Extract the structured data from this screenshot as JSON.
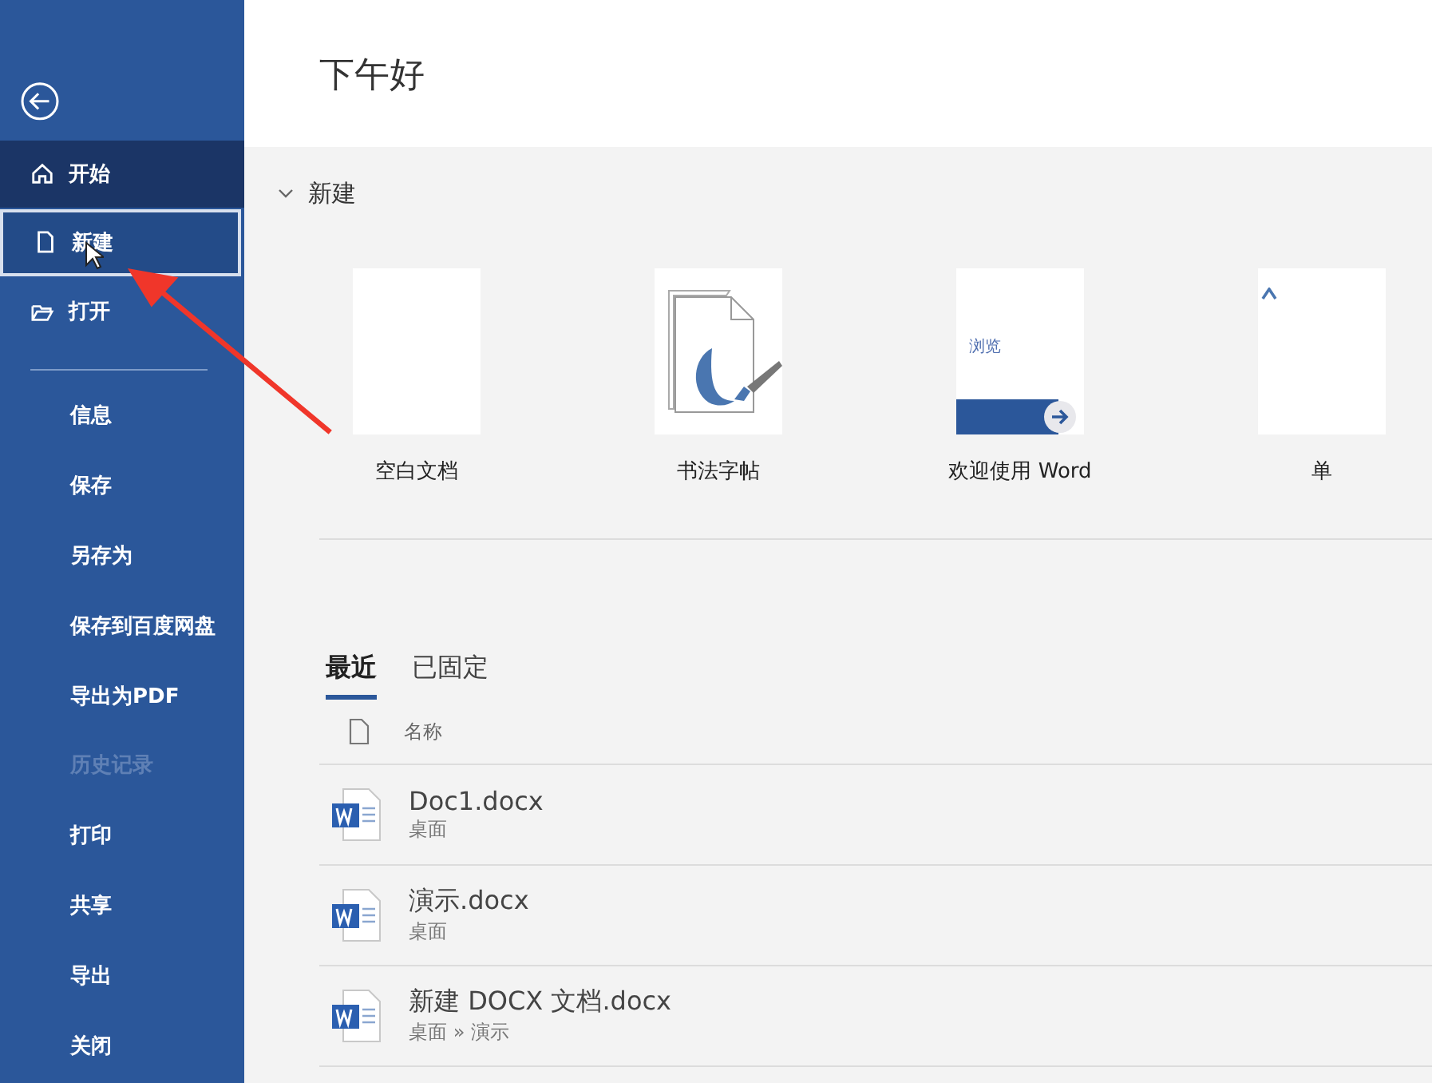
{
  "greeting": "下午好",
  "sidebar": {
    "items": [
      {
        "kind": "home",
        "label": "开始",
        "selected": true,
        "hovered": false,
        "disabled": false
      },
      {
        "kind": "file",
        "label": "新建",
        "selected": false,
        "hovered": true,
        "disabled": false
      },
      {
        "kind": "folder",
        "label": "打开",
        "selected": false,
        "hovered": false,
        "disabled": false
      },
      {
        "kind": "divider"
      },
      {
        "kind": "plain",
        "label": "信息",
        "selected": false,
        "hovered": false,
        "disabled": false
      },
      {
        "kind": "plain",
        "label": "保存",
        "selected": false,
        "hovered": false,
        "disabled": false
      },
      {
        "kind": "plain",
        "label": "另存为",
        "selected": false,
        "hovered": false,
        "disabled": false
      },
      {
        "kind": "plain",
        "label": "保存到百度网盘",
        "selected": false,
        "hovered": false,
        "disabled": false
      },
      {
        "kind": "plain",
        "label": "导出为PDF",
        "selected": false,
        "hovered": false,
        "disabled": false
      },
      {
        "kind": "plain",
        "label": "历史记录",
        "selected": false,
        "hovered": false,
        "disabled": true
      },
      {
        "kind": "plain",
        "label": "打印",
        "selected": false,
        "hovered": false,
        "disabled": false
      },
      {
        "kind": "plain",
        "label": "共享",
        "selected": false,
        "hovered": false,
        "disabled": false
      },
      {
        "kind": "plain",
        "label": "导出",
        "selected": false,
        "hovered": false,
        "disabled": false
      },
      {
        "kind": "plain",
        "label": "关闭",
        "selected": false,
        "hovered": false,
        "disabled": false
      }
    ]
  },
  "new_section": {
    "title": "新建",
    "expanded": true,
    "templates": [
      {
        "kind": "blank",
        "label": "空白文档"
      },
      {
        "kind": "calligraphy",
        "label": "书法字帖"
      },
      {
        "kind": "welcome",
        "label": "欢迎使用 Word",
        "thumb_text": "浏览"
      },
      {
        "kind": "partial",
        "label": "单"
      }
    ]
  },
  "tabs": [
    {
      "label": "最近",
      "selected": true
    },
    {
      "label": "已固定",
      "selected": false
    }
  ],
  "files": {
    "column": "名称",
    "rows": [
      {
        "name": "Doc1.docx",
        "path": "桌面"
      },
      {
        "name": "演示.docx",
        "path": "桌面"
      },
      {
        "name": "新建 DOCX 文档.docx",
        "path": "桌面 » 演示"
      }
    ]
  }
}
